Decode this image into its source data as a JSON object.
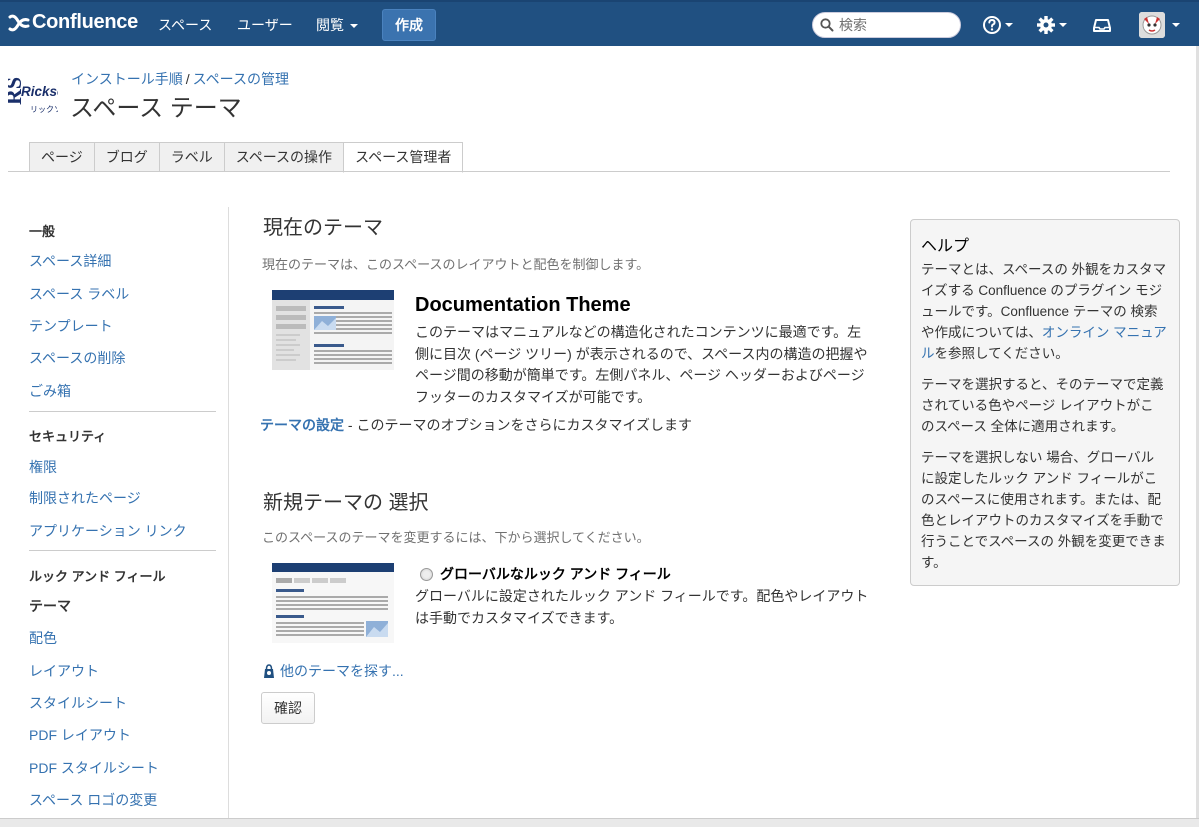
{
  "topnav": {
    "logo": "Confluence",
    "links": [
      "スペース",
      "ユーザー",
      "閲覧"
    ],
    "create_label": "作成",
    "search_placeholder": "検索"
  },
  "header": {
    "breadcrumb": [
      "インストール手順",
      "スペースの管理"
    ],
    "title": "スペース テーマ"
  },
  "tabs": [
    "ページ",
    "ブログ",
    "ラベル",
    "スペースの操作",
    "スペース管理者"
  ],
  "sidebar": {
    "general_heading": "一般",
    "general": [
      "スペース詳細",
      "スペース ラベル",
      "テンプレート",
      "スペースの削除",
      "ごみ箱"
    ],
    "security_heading": "セキュリティ",
    "security": [
      "権限",
      "制限されたページ",
      "アプリケーション リンク"
    ],
    "look_heading": "ルック アンド フィール",
    "look": [
      "テーマ",
      "配色",
      "レイアウト",
      "スタイルシート",
      "PDF レイアウト",
      "PDF スタイルシート",
      "スペース ロゴの変更"
    ]
  },
  "main": {
    "current_heading": "現在のテーマ",
    "current_desc": "現在のテーマは、このスペースのレイアウトと配色を制御します。",
    "theme_name": "Documentation Theme",
    "theme_desc": "このテーマはマニュアルなどの構造化されたコンテンツに最適です。左側に目次 (ページ ツリー) が表示されるので、スペース内の構造の把握やページ間の移動が簡単です。左側パネル、ページ ヘッダーおよびページ フッターのカスタマイズが可能です。",
    "config_link": "テーマの設定",
    "config_text": " - このテーマのオプションをさらにカスタマイズします",
    "new_heading": "新規テーマの 選択",
    "new_desc": "このスペースのテーマを変更するには、下から選択してください。",
    "global_label": "グローバルなルック アンド フィール",
    "global_desc": "グローバルに設定されたルック アンド フィールです。配色やレイアウトは手動でカスタマイズできます。",
    "find_themes": "他のテーマを探す...",
    "confirm": "確認"
  },
  "help": {
    "title": "ヘルプ",
    "p1_a": "テーマとは、スペースの 外観をカスタマイズする Confluence のプラグイン モジュールです。Confluence テーマの 検索や作成については、",
    "p1_link": "オンライン マニュアル",
    "p1_b": "を参照してください。",
    "p2": "テーマを選択すると、そのテーマで定義されている色やページ レイアウトがこのスペース 全体に適用されます。",
    "p3": "テーマを選択しない 場合、グローバルに設定したルック アンド フィールがこのスペースに使用されます。または、配色とレイアウトのカスタマイズを手動で行うことでスペースの 外観を変更できます。"
  },
  "colors": {
    "nav_bg": "#205081",
    "link": "#3572b0"
  }
}
